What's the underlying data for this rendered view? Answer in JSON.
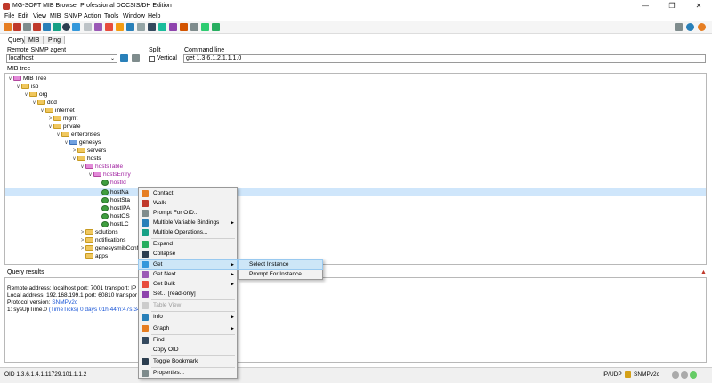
{
  "window": {
    "title": "MG-SOFT MIB Browser Professional DOCSIS/DH Edition"
  },
  "menubar": [
    "File",
    "Edit",
    "View",
    "MIB",
    "SNMP",
    "Action",
    "Tools",
    "Window",
    "Help"
  ],
  "tabs": [
    "Query",
    "MIB",
    "Ping"
  ],
  "agent": {
    "label": "Remote SNMP agent",
    "value": "localhost",
    "split_label": "Split",
    "vertical_label": "Vertical",
    "command_label": "Command line",
    "command_value": "get 1.3.6.1.2.1.1.1.0"
  },
  "tree": {
    "label": "MIB tree",
    "nodes": [
      "MIB Tree",
      "iso",
      "org",
      "dod",
      "internet",
      "mgmt",
      "private",
      "enterprises",
      "genesys",
      "servers",
      "hosts",
      "hostsTable",
      "hostsEntry",
      "hostId",
      "hostNa",
      "hostSta",
      "hostIPA",
      "hostOS",
      "hostLC",
      "solutions",
      "notifications",
      "genesysmibConfo",
      "apps"
    ]
  },
  "results": {
    "label": "Query results",
    "lines": [
      "Remote address: localhost  port: 7001 transport: IP",
      "Local address: 192.168.199.1  port: 60810 transpor",
      "Protocol version: ",
      "1: sysUpTime.0 "
    ],
    "protocol": "SNMPv2c",
    "uptime_type": "(TimeTicks)",
    "uptime_value": "0 days 01h:44m:47s.34"
  },
  "context_menu": [
    "Contact",
    "Walk",
    "Prompt For OID...",
    "Multiple Variable Bindings",
    "Multiple Operations...",
    "Expand",
    "Collapse",
    "Get",
    "Get Next",
    "Get Bulk",
    "Set...  [read-only]",
    "Table View",
    "Info",
    "Graph",
    "Find",
    "Copy OID",
    "Toggle Bookmark",
    "Properties..."
  ],
  "submenu": [
    "Select Instance",
    "Prompt For Instance..."
  ],
  "status": {
    "oid": "OID 1.3.6.1.4.1.11729.101.1.1.2",
    "transport": "IP/UDP",
    "version": "SNMPv2c"
  },
  "colors": {
    "selection": "#cfe6fb",
    "menu_highlight": "#cde6f7",
    "link_blue": "#1a56d6"
  }
}
